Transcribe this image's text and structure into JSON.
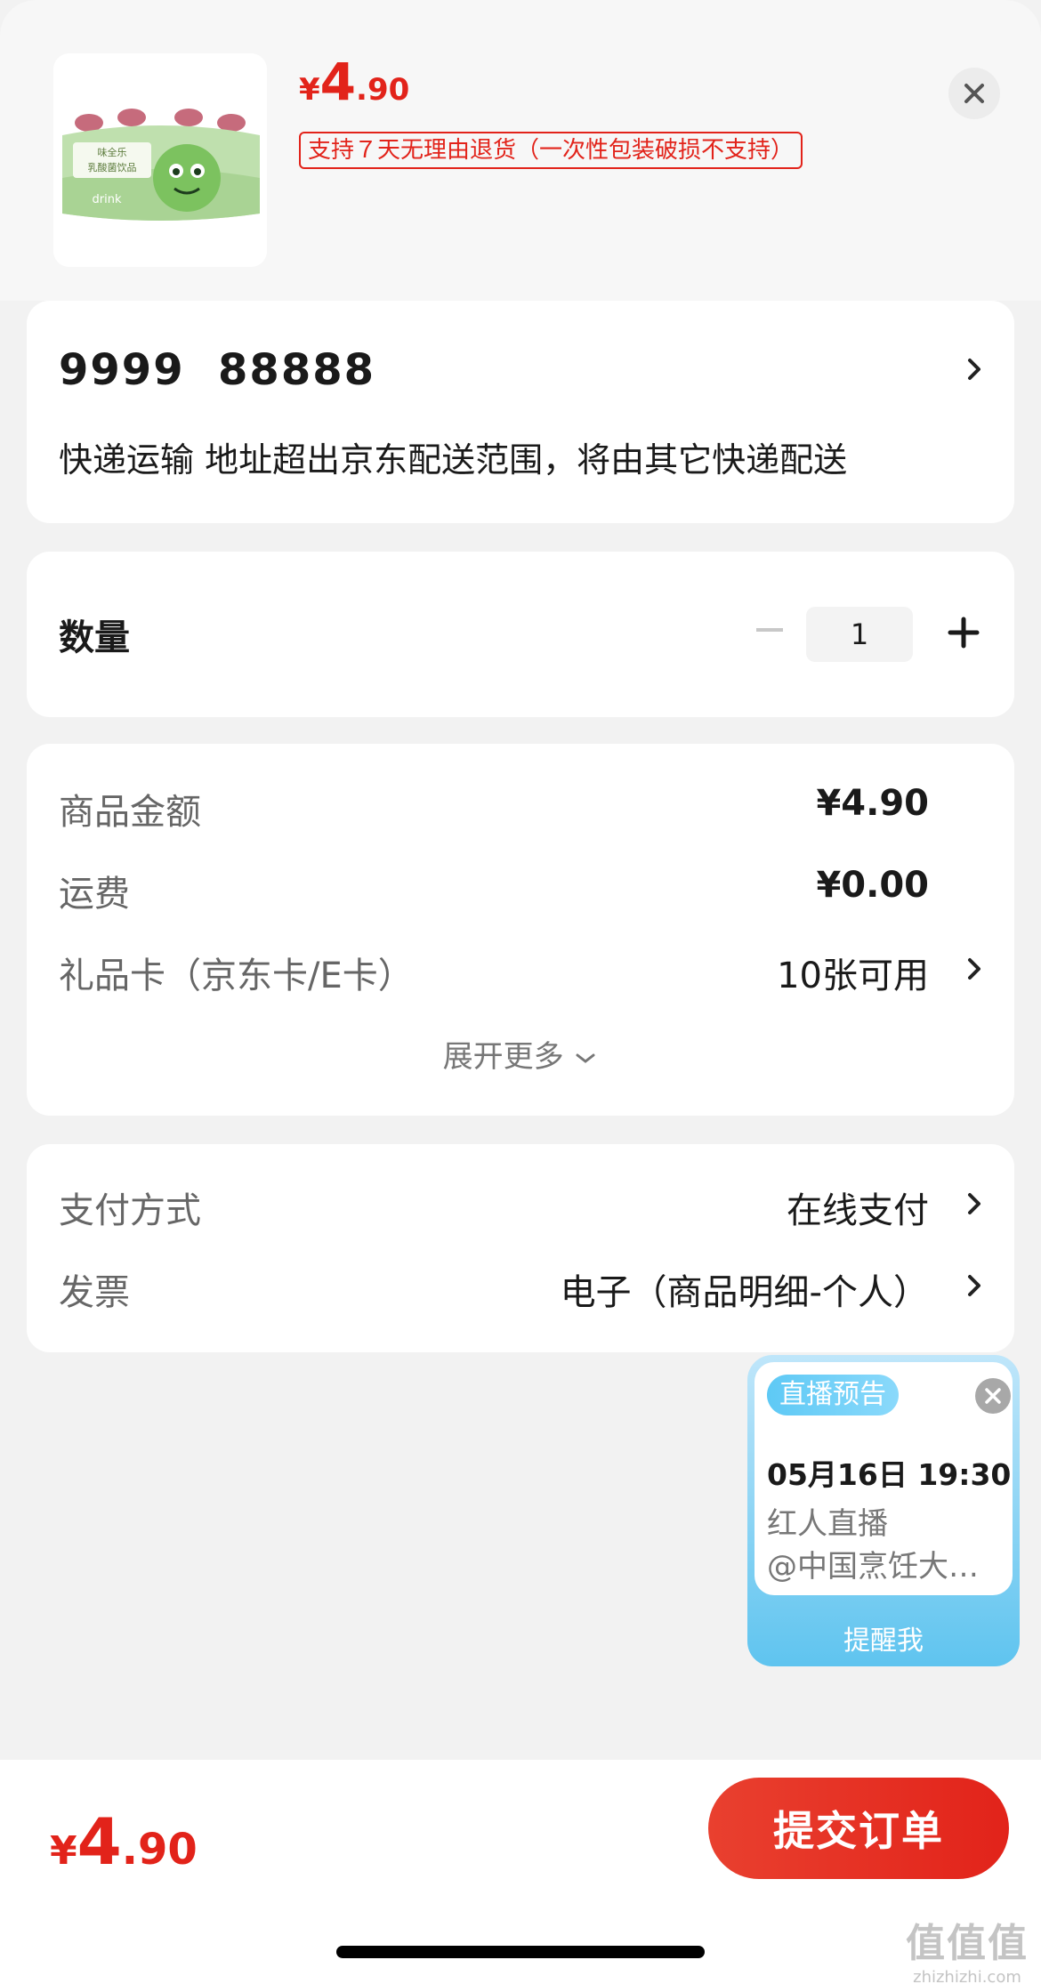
{
  "product": {
    "price_symbol": "¥",
    "price_int": "4",
    "price_dec": ".90",
    "return_policy": "支持７天无理由退货（一次性包装破损不支持）",
    "image_text_brand": "味全乐",
    "image_text_name": "乳酸菌饮品",
    "image_text_drink": "drink"
  },
  "address": {
    "title": "9999  88888",
    "delivery_note": "快递运输 地址超出京东配送范围，将由其它快递配送"
  },
  "quantity": {
    "label": "数量",
    "value": "1"
  },
  "amounts": {
    "goods_label": "商品金额",
    "goods_value": "¥4.90",
    "shipping_label": "运费",
    "shipping_value": "¥0.00",
    "giftcard_label": "礼品卡（京东卡/E卡）",
    "giftcard_value": "10张可用",
    "expand_label": "展开更多"
  },
  "payment": {
    "method_label": "支付方式",
    "method_value": "在线支付",
    "invoice_label": "发票",
    "invoice_value": "电子（商品明细-个人）"
  },
  "live": {
    "badge": "直播预告",
    "time": "05月16日 19:30",
    "desc_line1": "红人直播",
    "desc_line2": "@中国烹饪大…",
    "remind": "提醒我"
  },
  "footer": {
    "price_symbol": "¥",
    "price_int": "4",
    "price_dec": ".90",
    "submit_label": "提交订单"
  },
  "watermark": {
    "big": "值值值",
    "small": "zhizhizhi.com"
  },
  "colors": {
    "accent": "#e2231a",
    "live_blue": "#5fc4ef",
    "background": "#f2f2f2"
  }
}
